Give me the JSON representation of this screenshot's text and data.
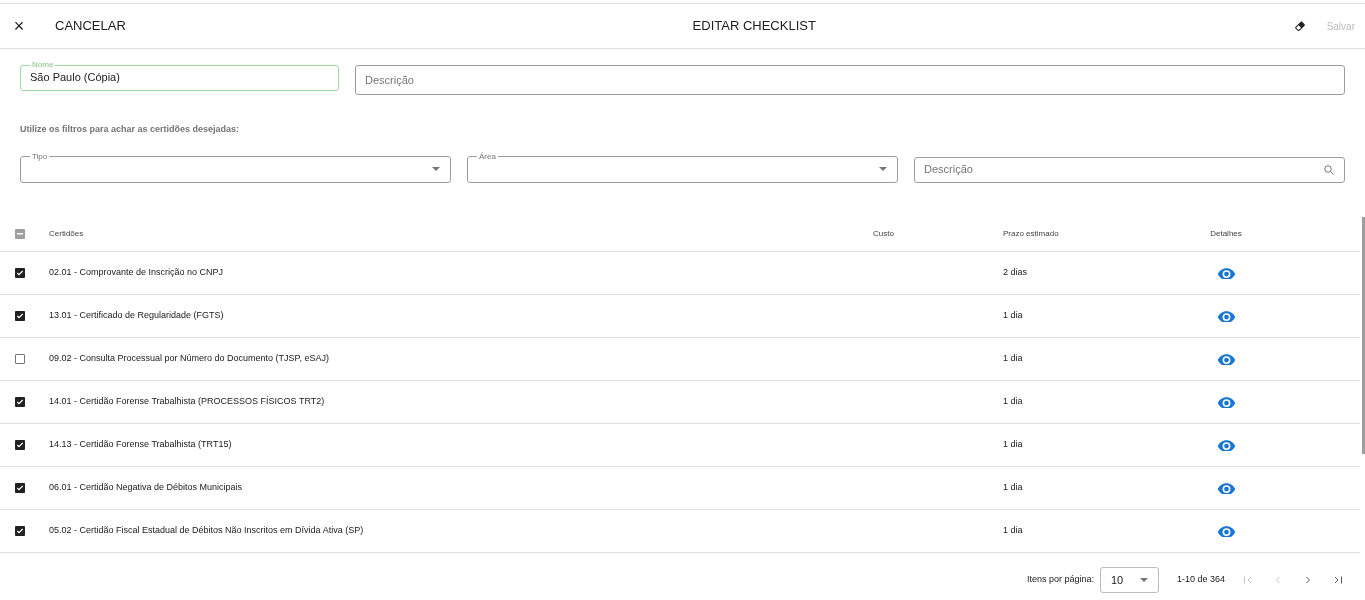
{
  "header": {
    "close_icon": "×",
    "cancel": "CANCELAR",
    "title": "EDITAR CHECKLIST",
    "save": {
      "label": "Salvar",
      "disabled": true
    }
  },
  "fields": [
    {
      "label": "Nome",
      "value": "São Paulo (Cópia)",
      "focused": true
    },
    {
      "placeholder": "Descrição",
      "focused": false
    }
  ],
  "filter_hint": "Utilize os filtros para achar as certidões desejadas:",
  "filters": [
    {
      "kind": "select",
      "label": "Tipo"
    },
    {
      "kind": "select",
      "label": "Área"
    },
    {
      "kind": "search",
      "placeholder": "Descrição"
    }
  ],
  "table": {
    "select_all_indeterminate": true,
    "columns": [
      "Certidões",
      "Custo",
      "Prazo estimado",
      "Detalhes"
    ],
    "rows": [
      {
        "checked": true,
        "name": "02.01 - Comprovante de Inscrição no CNPJ",
        "prazo": "2 dias"
      },
      {
        "checked": true,
        "name": "13.01 - Certificado de Regularidade (FGTS)",
        "prazo": "1 dia"
      },
      {
        "checked": false,
        "name": "09.02 - Consulta Processual por Número do Documento (TJSP, eSAJ)",
        "prazo": "1 dia"
      },
      {
        "checked": true,
        "name": "14.01 - Certidão Forense Trabalhista (PROCESSOS FÍSICOS TRT2)",
        "prazo": "1 dia"
      },
      {
        "checked": true,
        "name": "14.13 - Certidão Forense Trabalhista (TRT15)",
        "prazo": "1 dia"
      },
      {
        "checked": true,
        "name": "06.01 - Certidão Negativa de Débitos Municipais",
        "prazo": "1 dia"
      },
      {
        "checked": true,
        "name": "05.02 - Certidão Fiscal Estadual de Débitos Não Inscritos em Dívida Ativa (SP)",
        "prazo": "1 dia"
      }
    ]
  },
  "paginator": {
    "items_label": "Itens por página:",
    "page_size": "10",
    "range": "1-10 de 364",
    "buttons": [
      {
        "kind": "first",
        "disabled": true
      },
      {
        "kind": "prev",
        "disabled": true
      },
      {
        "kind": "next",
        "disabled": false
      },
      {
        "kind": "last",
        "disabled": false
      }
    ]
  }
}
